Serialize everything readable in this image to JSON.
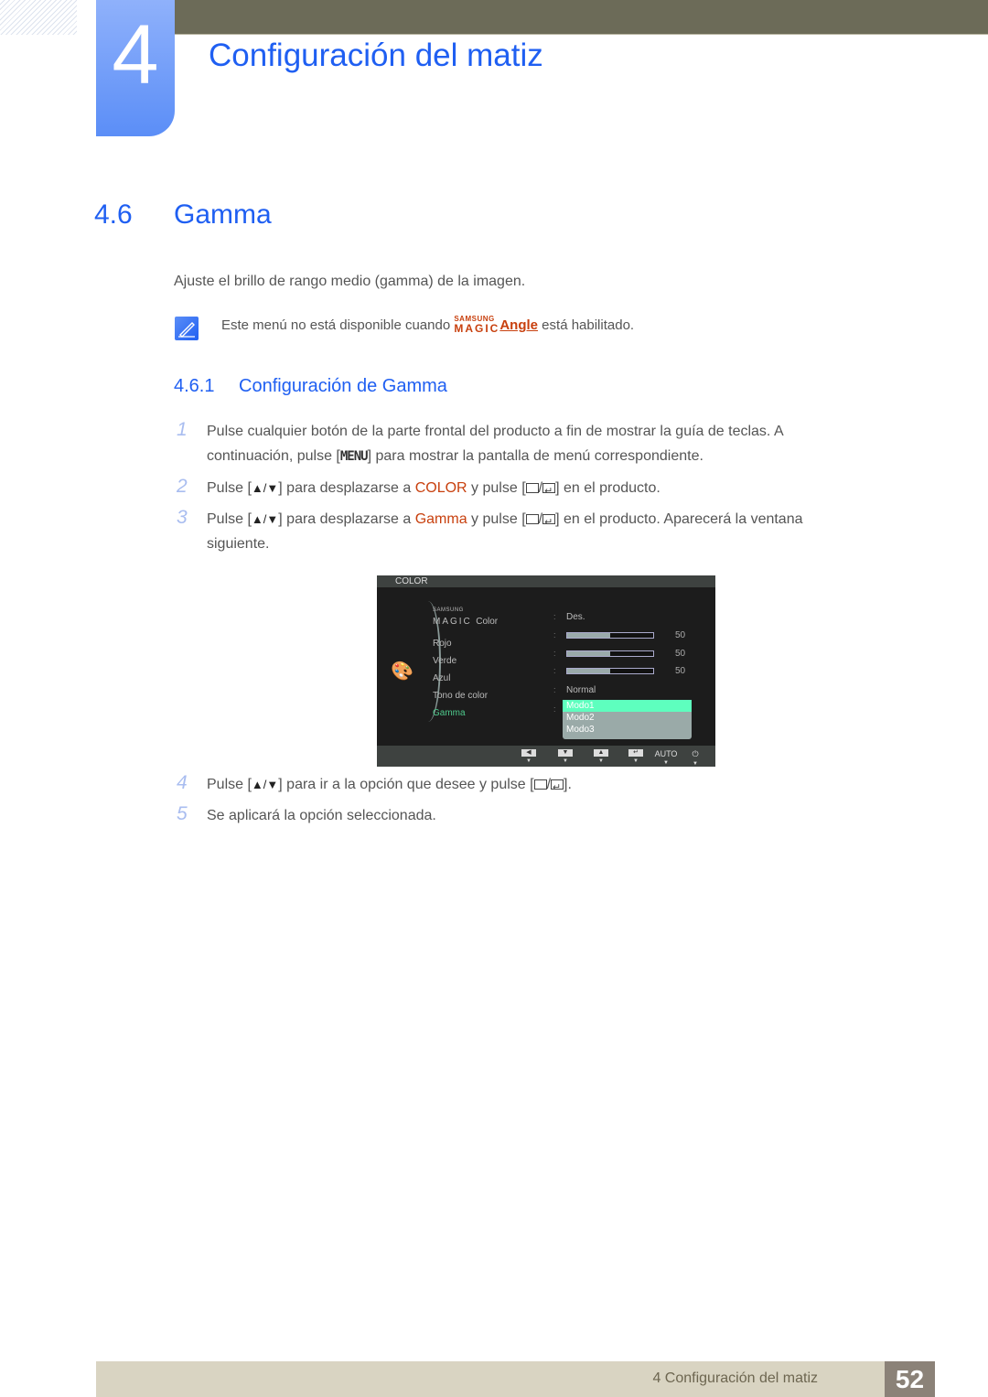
{
  "header": {
    "chapter_number": "4",
    "chapter_title": "Configuración del matiz"
  },
  "section": {
    "number": "4.6",
    "title": "Gamma",
    "intro": "Ajuste el brillo de rango medio (gamma) de la imagen.",
    "note": {
      "icon": "note-pencil-icon",
      "text_before": "Este menú no está disponible cuando ",
      "brand_top": "SAMSUNG",
      "brand_bottom": "MAGIC",
      "link": "Angle",
      "text_after": " está habilitado."
    }
  },
  "subsection": {
    "number": "4.6.1",
    "title": "Configuración de Gamma"
  },
  "steps": [
    {
      "num": "1",
      "line1": "Pulse cualquier botón de la parte frontal del producto a fin de mostrar la guía de teclas. A",
      "line2a": "continuación, pulse [",
      "key": "MENU",
      "line2b": "] para mostrar la pantalla de menú correspondiente."
    },
    {
      "num": "2",
      "a": "Pulse [",
      "b": "] para desplazarse a ",
      "hl": "COLOR",
      "c": " y pulse [",
      "d": "] en el producto."
    },
    {
      "num": "3",
      "a": "Pulse [",
      "b": "] para desplazarse a ",
      "hl": "Gamma",
      "c": " y pulse [",
      "d": "] en el producto. Aparecerá la ventana",
      "e": "siguiente."
    },
    {
      "num": "4",
      "a": "Pulse [",
      "b": "] para ir a la opción que desee y pulse [",
      "d": "]."
    },
    {
      "num": "5",
      "text": "Se aplicará la opción seleccionada."
    }
  ],
  "osd": {
    "title": "COLOR",
    "magic_top": "SAMSUNG",
    "magic_bottom": "MAGIC",
    "magic_label": "Color",
    "items": [
      "Rojo",
      "Verde",
      "Azul",
      "Tono de color",
      "Gamma"
    ],
    "active_item": "Gamma",
    "magic_value": "Des.",
    "sliders": [
      {
        "name": "Rojo",
        "value": 50,
        "max": 100
      },
      {
        "name": "Verde",
        "value": 50,
        "max": 100
      },
      {
        "name": "Azul",
        "value": 50,
        "max": 100
      }
    ],
    "tone_value": "Normal",
    "gamma_options": [
      "Modo1",
      "Modo2",
      "Modo3"
    ],
    "gamma_selected": "Modo1",
    "footer_keys": [
      "left-arrow",
      "down-arrow",
      "up-arrow",
      "enter",
      "AUTO",
      "power"
    ],
    "auto_label": "AUTO"
  },
  "footer": {
    "text": "4 Configuración del matiz",
    "page": "52"
  }
}
